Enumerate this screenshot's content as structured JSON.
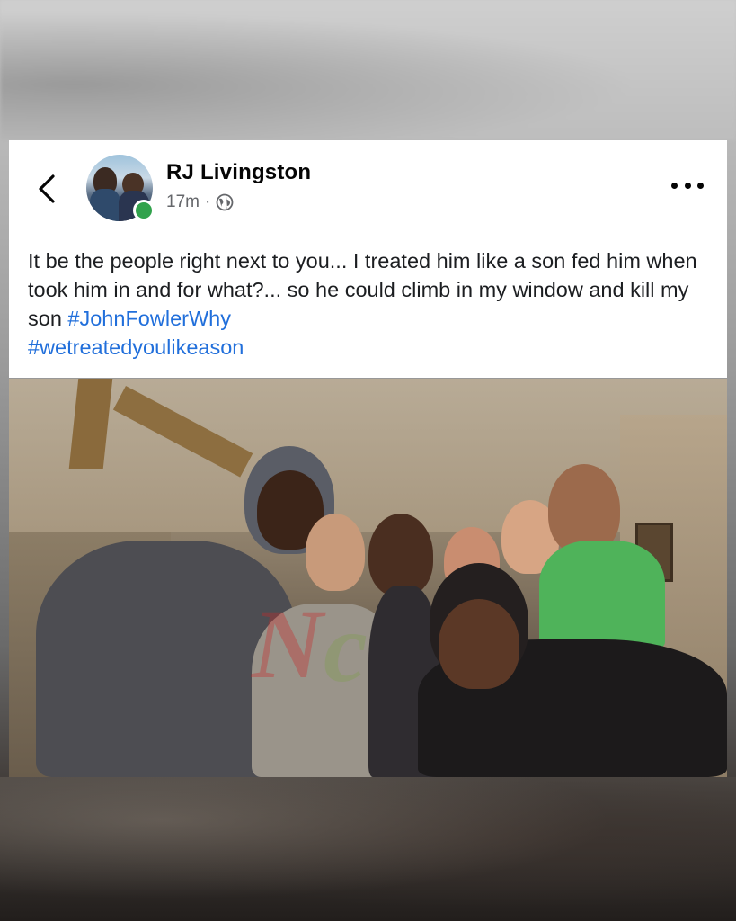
{
  "post": {
    "author": "RJ Livingston",
    "time": "17m",
    "separator": "·",
    "text": "It be the people right next to you... I treated him like a son fed him when took him in and for what?... so he could climb in my window and kill my son ",
    "hashtags": [
      "#JohnFowlerWhy",
      "#wetreatedyoulikeason"
    ]
  },
  "icons": {
    "back": "chevron-left-icon",
    "audience": "globe-icon",
    "more": "more-options-icon"
  },
  "colors": {
    "hashtag": "#216fdb",
    "online": "#31a24c",
    "meta_text": "#65676b"
  }
}
